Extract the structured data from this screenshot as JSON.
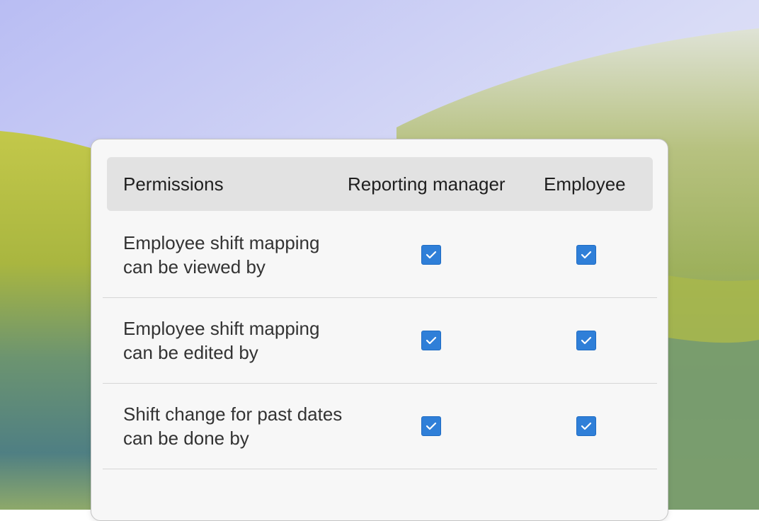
{
  "table": {
    "headers": {
      "permissions": "Permissions",
      "reporting_manager": "Reporting manager",
      "employee": "Employee"
    },
    "rows": [
      {
        "label_line1": "Employee shift mapping",
        "label_line2": "can be viewed by",
        "reporting_manager_checked": true,
        "employee_checked": true
      },
      {
        "label_line1": "Employee shift mapping",
        "label_line2": "can be edited by",
        "reporting_manager_checked": true,
        "employee_checked": true
      },
      {
        "label_line1": "Shift change for past dates",
        "label_line2": "can be done by",
        "reporting_manager_checked": true,
        "employee_checked": true
      }
    ]
  },
  "colors": {
    "checkbox": "#2f7fd8",
    "header_bg": "#e2e2e2",
    "panel_bg": "#f7f7f7",
    "sky": "#c9cdf2",
    "hill_green": "#b7c14a",
    "hill_teal": "#5e8c7c"
  },
  "icons": {
    "checkbox_check": "check-icon"
  }
}
